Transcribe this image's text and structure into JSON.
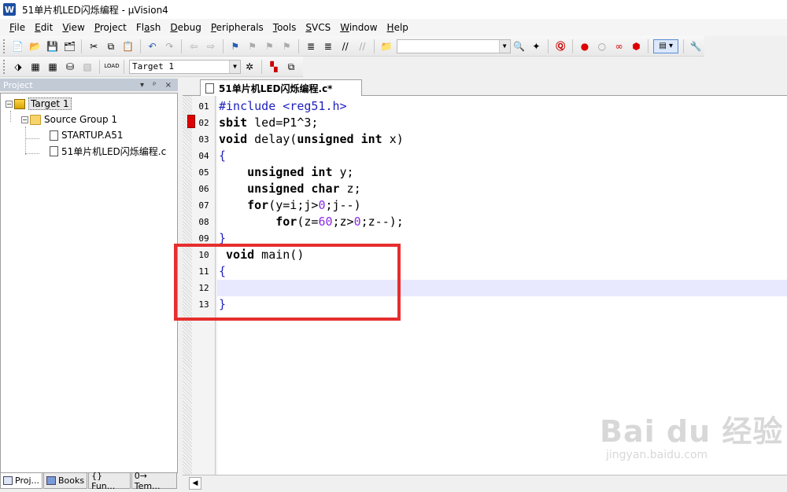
{
  "window": {
    "title": "51单片机LED闪烁编程  - μVision4",
    "app_icon": "W"
  },
  "menu": [
    {
      "label": "File",
      "mnemonic": "F",
      "rest": "ile"
    },
    {
      "label": "Edit",
      "mnemonic": "E",
      "rest": "dit"
    },
    {
      "label": "View",
      "mnemonic": "V",
      "rest": "iew"
    },
    {
      "label": "Project",
      "mnemonic": "P",
      "rest": "roject"
    },
    {
      "label": "Flash",
      "mnemonic": "F",
      "rest": "lash",
      "prefix": ""
    },
    {
      "label": "Debug",
      "mnemonic": "D",
      "rest": "ebug"
    },
    {
      "label": "Peripherals",
      "mnemonic": "P",
      "rest": "eripherals"
    },
    {
      "label": "Tools",
      "mnemonic": "T",
      "rest": "ools"
    },
    {
      "label": "SVCS",
      "mnemonic": "S",
      "rest": "VCS"
    },
    {
      "label": "Window",
      "mnemonic": "W",
      "rest": "indow"
    },
    {
      "label": "Help",
      "mnemonic": "H",
      "rest": "elp"
    }
  ],
  "toolbar2": {
    "target_select": "Target 1"
  },
  "project_panel": {
    "header": "Project",
    "header_buttons": "▾ ᵖ ×",
    "tree": {
      "target": "Target 1",
      "group": "Source Group 1",
      "files": [
        "STARTUP.A51",
        "51单片机LED闪烁编程.c"
      ]
    },
    "bottom_tabs": [
      "Proj...",
      "Books",
      "{} Fun...",
      "0→ Tem..."
    ]
  },
  "editor": {
    "tab_label": "51单片机LED闪烁编程.c*",
    "line_numbers": [
      "01",
      "02",
      "03",
      "04",
      "05",
      "06",
      "07",
      "08",
      "09",
      "10",
      "11",
      "12",
      "13"
    ],
    "highlighted_line": 12
  },
  "watermark": {
    "brand": "Bai du 经验",
    "url": "jingyan.baidu.com"
  },
  "colors": {
    "breakpoint": "#e00000",
    "annotation_box": "#e62e2e",
    "current_line": "#e8e8ff"
  }
}
